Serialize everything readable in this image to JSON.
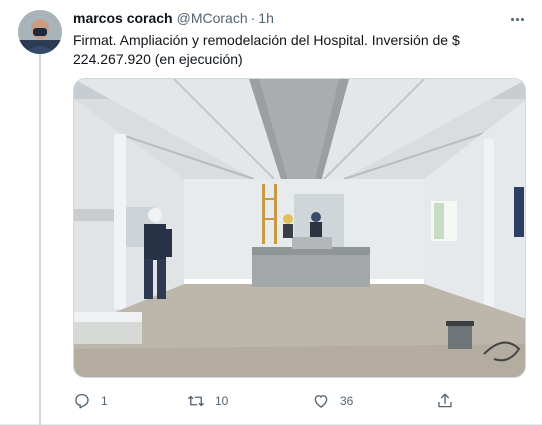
{
  "tweet": {
    "author_name": "marcos corach",
    "author_handle": "@MCorach",
    "separator": "·",
    "time": "1h",
    "text": "Firmat. Ampliación y remodelación del Hospital. Inversión de $ 224.267.920 (en ejecución)",
    "media_alt": "Interior de pabellón en obra con trabajadores"
  },
  "actions": {
    "reply_icon": "reply-icon",
    "reply_count": "1",
    "retweet_icon": "retweet-icon",
    "retweet_count": "10",
    "like_icon": "heart-icon",
    "like_count": "36",
    "share_icon": "share-icon"
  },
  "colors": {
    "text_primary": "#0f1419",
    "text_secondary": "#536471",
    "border": "#cfd9de"
  }
}
